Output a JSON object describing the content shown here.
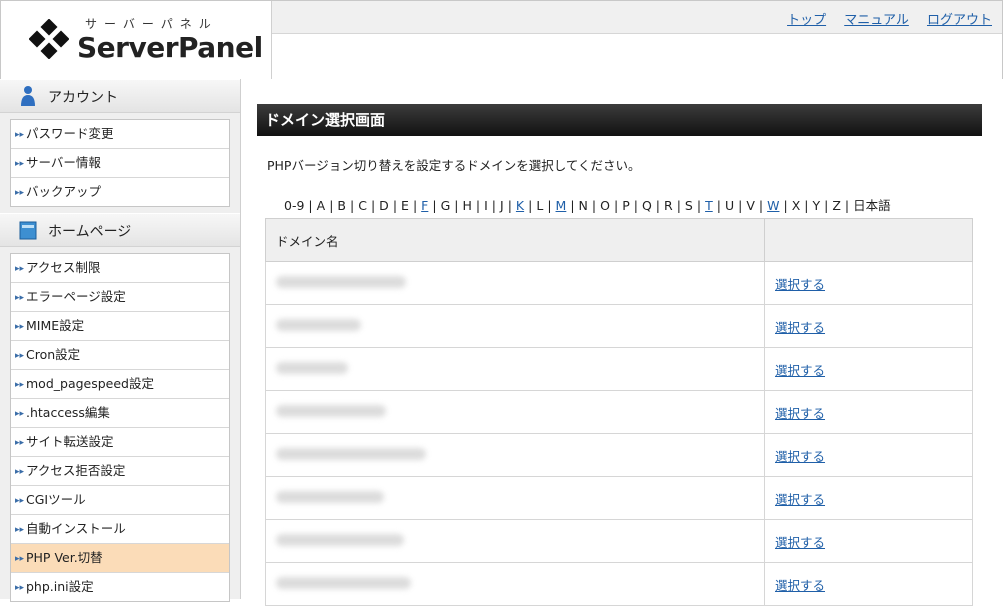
{
  "header": {
    "logo_kana": "サーバーパネル",
    "logo_text": "ServerPanel",
    "links": [
      "トップ",
      "マニュアル",
      "ログアウト"
    ]
  },
  "sidebar": {
    "sections": [
      {
        "title": "アカウント",
        "icon": "account-icon",
        "items": [
          "パスワード変更",
          "サーバー情報",
          "バックアップ"
        ]
      },
      {
        "title": "ホームページ",
        "icon": "homepage-icon",
        "items": [
          "アクセス制限",
          "エラーページ設定",
          "MIME設定",
          "Cron設定",
          "mod_pagespeed設定",
          ".htaccess編集",
          "サイト転送設定",
          "アクセス拒否設定",
          "CGIツール",
          "自動インストール",
          "PHP Ver.切替",
          "php.ini設定"
        ]
      }
    ],
    "active_item": "PHP Ver.切替"
  },
  "main": {
    "title": "ドメイン選択画面",
    "description": "PHPバージョン切り替えを設定するドメインを選択してください。",
    "alphabet": [
      {
        "t": "0-9",
        "link": false
      },
      {
        "t": "A",
        "link": false
      },
      {
        "t": "B",
        "link": false
      },
      {
        "t": "C",
        "link": false
      },
      {
        "t": "D",
        "link": false
      },
      {
        "t": "E",
        "link": false
      },
      {
        "t": "F",
        "link": true
      },
      {
        "t": "G",
        "link": false
      },
      {
        "t": "H",
        "link": false
      },
      {
        "t": "I",
        "link": false
      },
      {
        "t": "J",
        "link": false
      },
      {
        "t": "K",
        "link": true
      },
      {
        "t": "L",
        "link": false
      },
      {
        "t": "M",
        "link": true
      },
      {
        "t": "N",
        "link": false
      },
      {
        "t": "O",
        "link": false
      },
      {
        "t": "P",
        "link": false
      },
      {
        "t": "Q",
        "link": false
      },
      {
        "t": "R",
        "link": false
      },
      {
        "t": "S",
        "link": false
      },
      {
        "t": "T",
        "link": true
      },
      {
        "t": "U",
        "link": false
      },
      {
        "t": "V",
        "link": false
      },
      {
        "t": "W",
        "link": true
      },
      {
        "t": "X",
        "link": false
      },
      {
        "t": "Y",
        "link": false
      },
      {
        "t": "Z",
        "link": false
      },
      {
        "t": "日本語",
        "link": false
      }
    ],
    "table": {
      "col_domain": "ドメイン名",
      "col_action": "",
      "select_label": "選択する",
      "row_count": 8
    }
  },
  "colors": {
    "accent_link": "#1f5fa8",
    "active_bg": "#fbdcb8",
    "title_bg": "#1a1a1a"
  }
}
